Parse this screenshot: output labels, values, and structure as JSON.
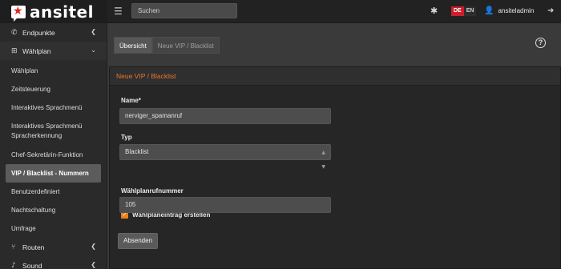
{
  "brand": {
    "name": "ansitel"
  },
  "topbar": {
    "search_placeholder": "Suchen",
    "lang_de": "DE",
    "lang_en": "EN",
    "username": "ansiteladmin"
  },
  "sidebar": {
    "groups": [
      {
        "label": "Endpunkte",
        "icon": "phone-icon"
      },
      {
        "label": "Wählplan",
        "icon": "sitemap-icon"
      },
      {
        "label": "Routen",
        "icon": "branch-icon"
      },
      {
        "label": "Sound",
        "icon": "music-icon"
      }
    ],
    "items": [
      "Wählplan",
      "Zeitsteuerung",
      "Interaktives Sprachmenü",
      "Interaktives Sprachmenü Spracherkennung",
      "Chef-Sekretärin-Funktion",
      "VIP / Blacklist - Nummern",
      "Benutzerdefiniert",
      "Nachtschaltung",
      "Umfrage"
    ]
  },
  "tabs": [
    "Übersicht",
    "Neue VIP / Blacklist"
  ],
  "panel": {
    "title": "Neue VIP / Blacklist",
    "name_label": "Name*",
    "name_value": "nerviger_spamanruf",
    "type_label": "Typ",
    "type_value": "Blacklist",
    "checkbox_label": "Wählplaneintrag erstellen",
    "number_label": "Wählplanrufnummer",
    "number_value": "105",
    "submit_label": "Absenden"
  },
  "colors": {
    "accent": "#e8772e",
    "lang_active": "#cc1f2a"
  }
}
